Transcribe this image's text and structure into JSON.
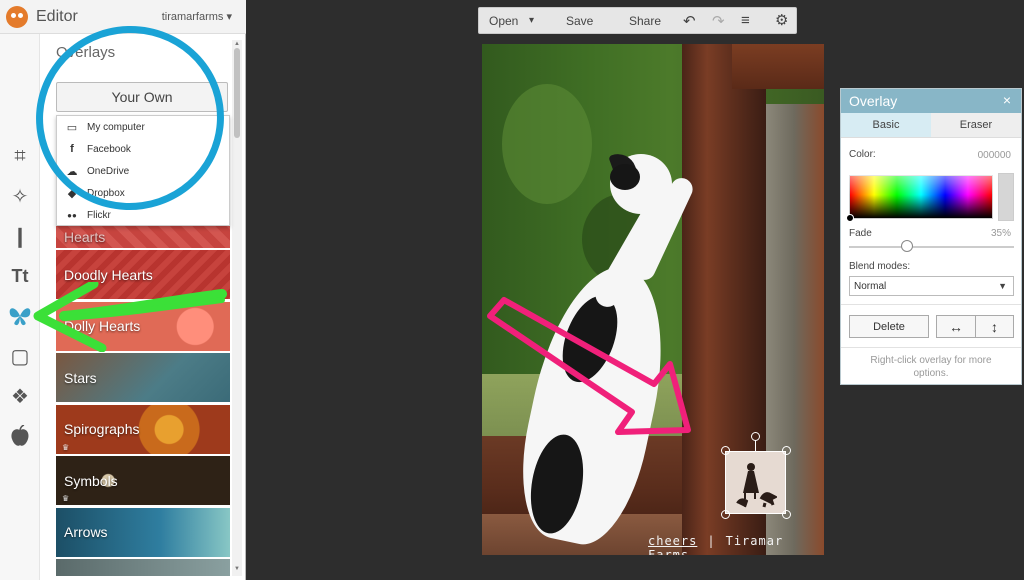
{
  "app": {
    "title": "Editor",
    "user": "tiramarfarms ▾"
  },
  "tools": [
    {
      "name": "crop-icon",
      "glyph": "⌗"
    },
    {
      "name": "magic-wand-icon",
      "glyph": "✧"
    },
    {
      "name": "touch-up-icon",
      "glyph": "❙"
    },
    {
      "name": "text-icon",
      "glyph": "Tt"
    },
    {
      "name": "butterfly-icon",
      "glyph": "🦋"
    },
    {
      "name": "frame-icon",
      "glyph": "▢"
    },
    {
      "name": "texture-icon",
      "glyph": "❖"
    },
    {
      "name": "seasonal-icon",
      "glyph": "●"
    }
  ],
  "panel": {
    "title": "Overlays",
    "your_own_label": "Your Own",
    "dropdown": [
      {
        "label": "My computer",
        "icon": "laptop-icon",
        "glyph": "▭"
      },
      {
        "label": "Facebook",
        "icon": "facebook-icon",
        "glyph": "f"
      },
      {
        "label": "OneDrive",
        "icon": "cloud-icon",
        "glyph": "☁"
      },
      {
        "label": "Dropbox",
        "icon": "dropbox-icon",
        "glyph": "◆"
      },
      {
        "label": "Flickr",
        "icon": "flickr-icon",
        "glyph": "●●"
      }
    ],
    "categories": [
      "Hearts",
      "Doodly Hearts",
      "Dolly Hearts",
      "Stars",
      "Spirographs",
      "Symbols",
      "Arrows",
      ""
    ]
  },
  "toolbar": {
    "open_label": "Open",
    "open_arrow": "▾",
    "save_label": "Save",
    "share_label": "Share",
    "undo_icon": "↶",
    "redo_icon": "↷",
    "layers_icon": "≡",
    "settings_icon": "⚙"
  },
  "photo": {
    "watermark_left": "cheers",
    "watermark_sep": "|",
    "watermark_right": "Tiramar Farms"
  },
  "overlay_panel": {
    "title": "Overlay",
    "close": "×",
    "tabs": [
      "Basic",
      "Eraser"
    ],
    "color_label": "Color:",
    "color_value": "000000",
    "fade_label": "Fade",
    "fade_value": "35%",
    "fade": 0.35,
    "blend_label": "Blend modes:",
    "blend_value": "Normal",
    "delete_label": "Delete",
    "flip_h_icon": "↔",
    "flip_v_icon": "↕",
    "hint": "Right-click overlay for more options."
  },
  "colors": {
    "accent": "#88b6c7",
    "annotation_blue": "#1aa3d6",
    "annotation_green": "#3be038",
    "annotation_pink": "#f0207a"
  }
}
